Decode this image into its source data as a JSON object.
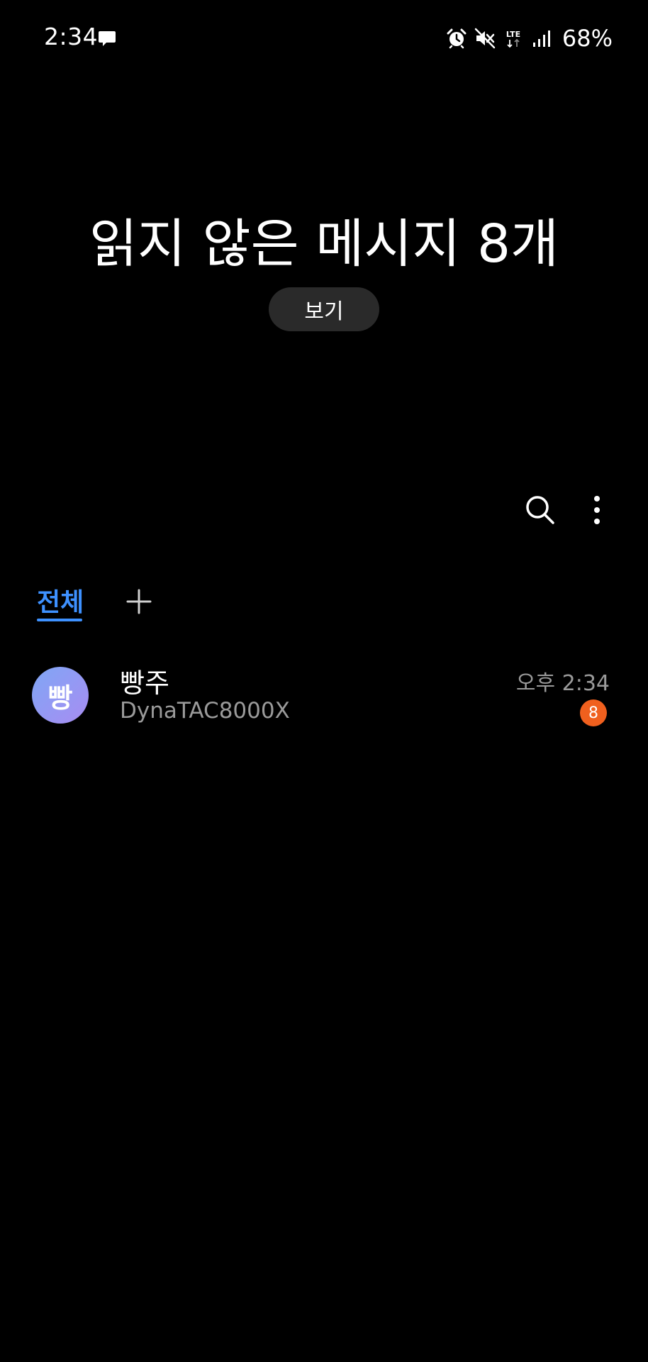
{
  "status_bar": {
    "time": "2:34",
    "battery": "68%",
    "icons": [
      "message-notification-icon",
      "alarm-icon",
      "mute-icon",
      "lte-icon",
      "signal-icon"
    ]
  },
  "header": {
    "title": "읽지 않은 메시지 8개",
    "view_button_label": "보기"
  },
  "toolbar": {
    "icons": [
      "search-icon",
      "more-options-icon"
    ]
  },
  "tabs": {
    "all_label": "전체",
    "add_icon": "plus-icon"
  },
  "conversations": [
    {
      "avatar_initial": "빵",
      "name": "빵주",
      "preview": "DynaTAC8000X",
      "time": "오후 2:34",
      "unread_count": "8"
    }
  ],
  "colors": {
    "background": "#000000",
    "accent": "#3e91ff",
    "badge": "#f0601e",
    "secondary_text": "#9a9a9a",
    "button_bg": "#2a2a2a"
  }
}
